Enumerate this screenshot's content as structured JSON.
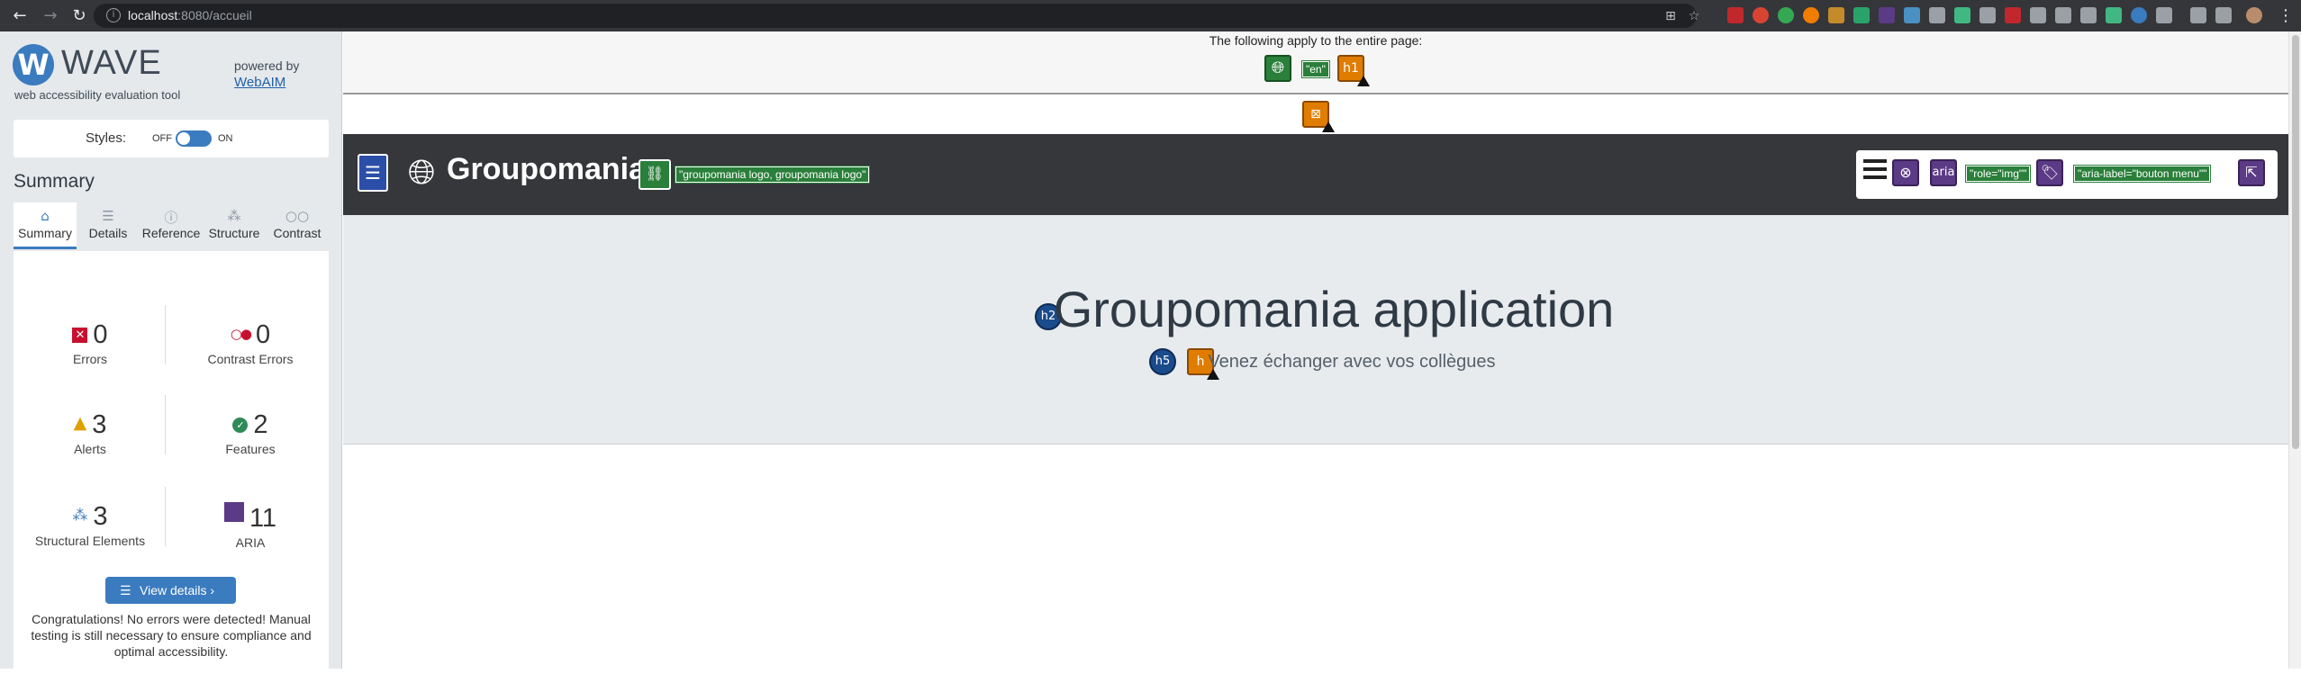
{
  "browser": {
    "url_host": "localhost",
    "url_path": ":8080/accueil"
  },
  "wave": {
    "logo_text": "WAVE",
    "tagline": "web accessibility evaluation tool",
    "powered_by": "powered by",
    "webaim": "WebAIM",
    "styles_label": "Styles:",
    "toggle_off": "OFF",
    "toggle_on": "ON",
    "summary_heading": "Summary",
    "tabs": [
      {
        "label": "Summary",
        "icon": "home-icon"
      },
      {
        "label": "Details",
        "icon": "list-icon"
      },
      {
        "label": "Reference",
        "icon": "info-icon"
      },
      {
        "label": "Structure",
        "icon": "structure-icon"
      },
      {
        "label": "Contrast",
        "icon": "contrast-icon"
      }
    ],
    "stats": {
      "errors": {
        "value": "0",
        "label": "Errors"
      },
      "contrast_errors": {
        "value": "0",
        "label": "Contrast Errors"
      },
      "alerts": {
        "value": "3",
        "label": "Alerts"
      },
      "features": {
        "value": "2",
        "label": "Features"
      },
      "structural": {
        "value": "3",
        "label": "Structural Elements"
      },
      "aria": {
        "value": "11",
        "label": "ARIA"
      }
    },
    "view_details": "View details ›",
    "congrats": "Congratulations! No errors were detected! Manual testing is still necessary to ensure compliance and optimal accessibility."
  },
  "page": {
    "apply_text": "The following apply to the entire page:",
    "lang_tag": "\"en\"",
    "h1": "h1",
    "brand": "Groupomania",
    "logo_alt_tag": "\"groupomania logo, groupomania logo\"",
    "aria_label": "aria",
    "role_tag": "\"role=\"img\"\"",
    "aria_label_tag": "\"aria-label=\"bouton menu\"\"",
    "h2": "h2",
    "hero_title": "Groupomania application",
    "h5": "h5",
    "h_icon": "h",
    "hero_sub": "Venez échanger avec vos collègues"
  },
  "colors": {
    "accent": "#3b7bbf",
    "navbar": "#36373b",
    "error": "#c8102e",
    "alert": "#e07c00",
    "feature": "#2a7f3a",
    "aria": "#5b3a86"
  }
}
